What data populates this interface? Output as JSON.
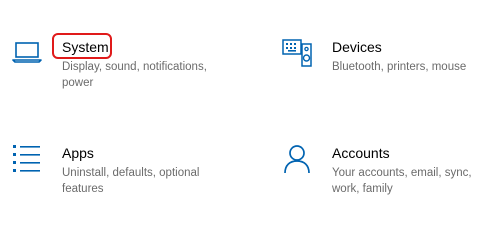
{
  "settings_tiles": [
    {
      "title": "System",
      "description": "Display, sound, notifications, power",
      "icon": "laptop-icon"
    },
    {
      "title": "Devices",
      "description": "Bluetooth, printers, mouse",
      "icon": "keyboard-speaker-icon"
    },
    {
      "title": "Apps",
      "description": "Uninstall, defaults, optional features",
      "icon": "apps-list-icon"
    },
    {
      "title": "Accounts",
      "description": "Your accounts, email, sync, work, family",
      "icon": "person-icon"
    }
  ],
  "colors": {
    "icon_accent": "#0063b1",
    "highlight_box": "#e01a1a",
    "description_text": "#6b6b6b"
  }
}
